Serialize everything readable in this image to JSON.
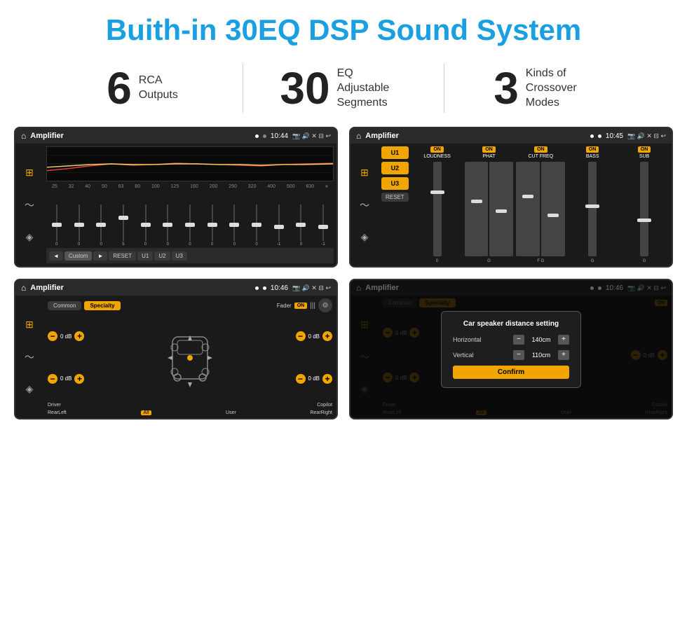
{
  "title": "Buith-in 30EQ DSP Sound System",
  "stats": [
    {
      "number": "6",
      "text": "RCA\nOutputs"
    },
    {
      "number": "30",
      "text": "EQ Adjustable\nSegments"
    },
    {
      "number": "3",
      "text": "Kinds of\nCrossover Modes"
    }
  ],
  "screens": [
    {
      "id": "eq-screen",
      "statusBar": {
        "title": "Amplifier",
        "time": "10:44"
      },
      "freqs": [
        "25",
        "32",
        "40",
        "50",
        "63",
        "80",
        "100",
        "125",
        "160",
        "200",
        "250",
        "320",
        "400",
        "500",
        "630"
      ],
      "sliderValues": [
        "0",
        "0",
        "0",
        "5",
        "0",
        "0",
        "0",
        "0",
        "0",
        "0",
        "-1",
        "0",
        "-1"
      ],
      "bottomBtns": [
        "◄",
        "Custom",
        "►",
        "RESET",
        "U1",
        "U2",
        "U3"
      ]
    },
    {
      "id": "cross-screen",
      "statusBar": {
        "title": "Amplifier",
        "time": "10:45"
      },
      "presets": [
        "U1",
        "U2",
        "U3"
      ],
      "channels": [
        {
          "label": "LOUDNESS",
          "on": true
        },
        {
          "label": "PHAT",
          "on": true
        },
        {
          "label": "CUT FREQ",
          "on": true
        },
        {
          "label": "BASS",
          "on": true
        },
        {
          "label": "SUB",
          "on": true
        }
      ],
      "resetBtn": "RESET"
    },
    {
      "id": "fader-screen",
      "statusBar": {
        "title": "Amplifier",
        "time": "10:46"
      },
      "tabs": [
        "Common",
        "Specialty"
      ],
      "activeTab": 1,
      "faderLabel": "Fader",
      "faderOn": "ON",
      "dbValues": [
        "0 dB",
        "0 dB",
        "0 dB",
        "0 dB"
      ],
      "bottomLabels": [
        "Driver",
        "",
        "Copilot",
        "RearLeft",
        "All",
        "",
        "User",
        "RearRight"
      ]
    },
    {
      "id": "dialog-screen",
      "statusBar": {
        "title": "Amplifier",
        "time": "10:46"
      },
      "tabs": [
        "Common",
        "Specialty"
      ],
      "dialog": {
        "title": "Car speaker distance setting",
        "rows": [
          {
            "label": "Horizontal",
            "value": "140cm"
          },
          {
            "label": "Vertical",
            "value": "110cm"
          }
        ],
        "confirmLabel": "Confirm"
      },
      "dbValues": [
        "0 dB",
        "0 dB"
      ],
      "bottomLabels": [
        "Driver",
        "",
        "Copilot",
        "RearLeft",
        "",
        "User",
        "RearRight"
      ]
    }
  ]
}
